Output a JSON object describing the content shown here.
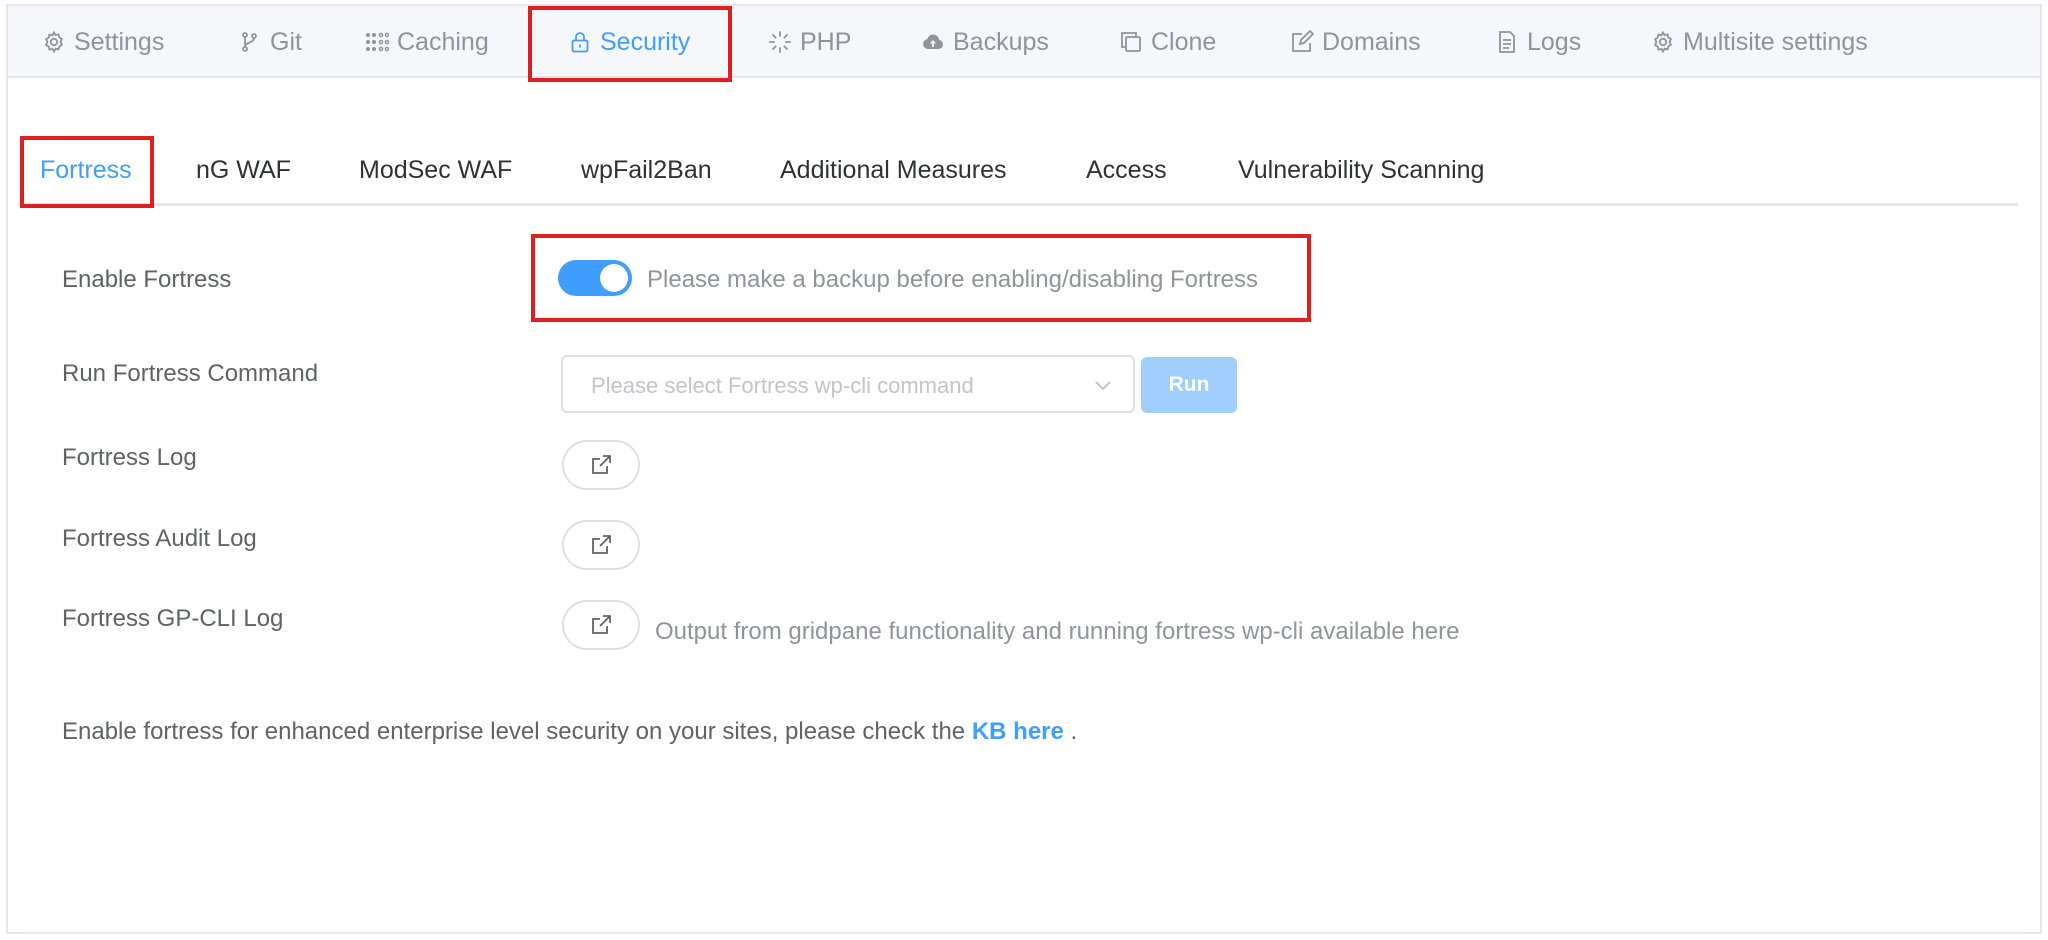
{
  "top_tabs": [
    {
      "label": "Settings",
      "icon": "gear-icon"
    },
    {
      "label": "Git",
      "icon": "git-branch-icon"
    },
    {
      "label": "Caching",
      "icon": "grid-dots-icon"
    },
    {
      "label": "Security",
      "icon": "lock-icon",
      "active": true
    },
    {
      "label": "PHP",
      "icon": "spinner-icon"
    },
    {
      "label": "Backups",
      "icon": "cloud-upload-icon"
    },
    {
      "label": "Clone",
      "icon": "copy-icon"
    },
    {
      "label": "Domains",
      "icon": "edit-icon"
    },
    {
      "label": "Logs",
      "icon": "document-icon"
    },
    {
      "label": "Multisite settings",
      "icon": "gear-icon"
    }
  ],
  "sub_tabs": [
    {
      "label": "Fortress",
      "active": true
    },
    {
      "label": "nG WAF"
    },
    {
      "label": "ModSec WAF"
    },
    {
      "label": "wpFail2Ban"
    },
    {
      "label": "Additional Measures"
    },
    {
      "label": "Access"
    },
    {
      "label": "Vulnerability Scanning"
    }
  ],
  "form": {
    "enable_fortress": {
      "label": "Enable Fortress",
      "enabled": true,
      "note": "Please make a backup before enabling/disabling Fortress"
    },
    "run_command": {
      "label": "Run Fortress Command",
      "placeholder": "Please select Fortress wp-cli command",
      "button": "Run"
    },
    "fortress_log": {
      "label": "Fortress Log"
    },
    "audit_log": {
      "label": "Fortress Audit Log"
    },
    "gpcli_log": {
      "label": "Fortress GP-CLI Log",
      "note": "Output from gridpane functionality and running fortress wp-cli available here"
    }
  },
  "footer": {
    "text": "Enable fortress for enhanced enterprise level security on your sites, please check the ",
    "link": "KB here",
    "suffix": " ."
  },
  "colors": {
    "accent": "#409eff",
    "highlight": "#e02020",
    "disabled_button": "#a0cfff"
  }
}
